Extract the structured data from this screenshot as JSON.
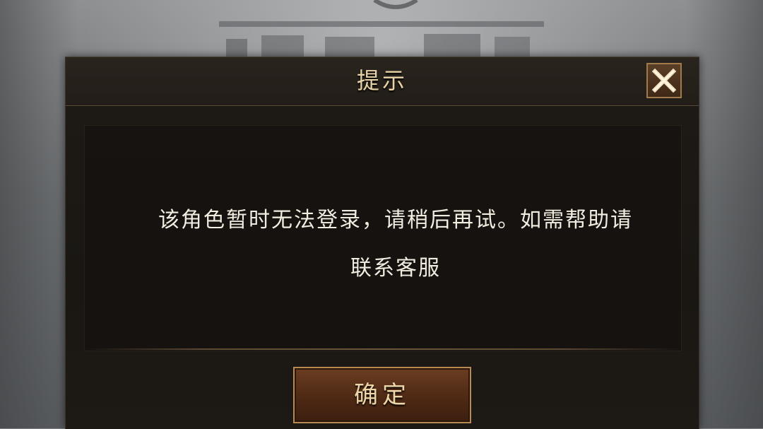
{
  "dialog": {
    "title": "提示",
    "close_icon": "close-x-icon",
    "message_line1": "该角色暂时无法登录，请稍后再试。如需帮助请",
    "message_line2": "联系客服",
    "confirm_label": "确定"
  },
  "colors": {
    "accent_gold": "#e7d3a6",
    "button_brown": "#4e2914",
    "dialog_bg": "#1e1a16"
  }
}
